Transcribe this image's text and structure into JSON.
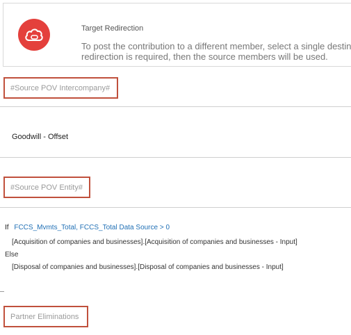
{
  "header": {
    "icon": "cloud-icon",
    "title": "Target Redirection",
    "description": "To post the contribution to a different member, select a single destin redirection is required, then the source members will be used."
  },
  "sections": {
    "intercompany": {
      "label": "#Source POV Intercompany#",
      "value": "Goodwill - Offset"
    },
    "entity": {
      "label": "#Source POV Entity#",
      "rule": {
        "if_keyword": "If",
        "condition": "FCCS_Mvmts_Total, FCCS_Total Data Source > 0",
        "then_value": "[Acquisition of companies and businesses].[Acquisition of companies and businesses - Input]",
        "else_keyword": "Else",
        "else_value": "[Disposal of companies and businesses].[Disposal of companies and businesses - Input]"
      }
    },
    "partner": {
      "label": "Partner Eliminations"
    }
  },
  "colors": {
    "accent_red": "#e4403c",
    "highlight_border": "#c0503c",
    "link_blue": "#1f6fb5"
  }
}
